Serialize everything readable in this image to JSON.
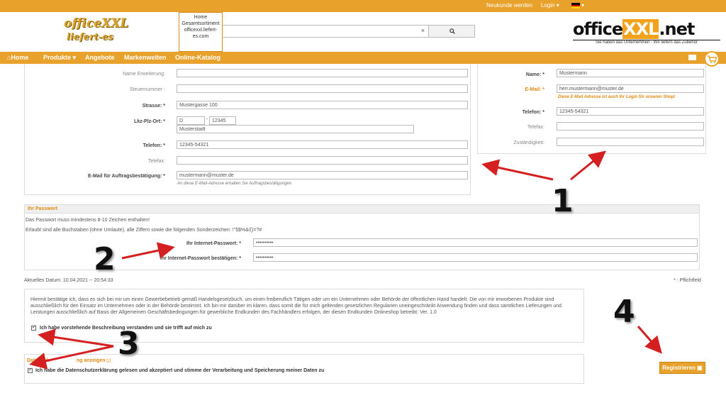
{
  "topbar": {
    "new_customer": "Neukunde werden",
    "login": "Login ▾",
    "language_caret": "▾"
  },
  "header": {
    "logo_left_line1": "officeXXL",
    "logo_left_line2": "liefert-es",
    "search_clear": "×",
    "popup_lines": [
      "Home",
      "Gesamtsortiment",
      "officexxl.liefert-",
      "es.com"
    ],
    "logo_right_office": "office",
    "logo_right_xxl": "XXL",
    "logo_right_net": ".net",
    "logo_right_tagline": "Sie haben das Unternehmen - Wir liefern das Zubehör"
  },
  "nav": {
    "items": [
      "Home",
      "Produkte ▾",
      "Angebote",
      "Markenwelten",
      "Online-Katalog"
    ]
  },
  "form_left": {
    "name_ext_label": "Name Erweiterung:",
    "tax_label": "Steuernummer :",
    "street_label": "Strasse: *",
    "street_value": "Mustergasse 100",
    "zip_label": "Lkz-Plz-Ort: *",
    "country_value": "D",
    "zip_value": "12345",
    "city_value": "Musterstadt",
    "phone_label": "Telefon: *",
    "phone_value": "12345-54321",
    "fax_label": "Telefax:",
    "email_label": "E-Mail für Auftragsbestätigung: *",
    "email_value": "mustermann@muster.de",
    "email_hint": "An diese E-Mail-Adresse erhalten Sie Auftragsbestätigungen"
  },
  "form_right": {
    "name_label": "Name: *",
    "name_value": "Mustermann",
    "email_label": "E-Mail: *",
    "email_value": "herr.mustermann@muster.de",
    "email_hint": "Diese E-Mail Adresse ist auch Ihr Login für unseren Shop!",
    "phone_label": "Telefon: *",
    "phone_value": "12345-54321",
    "fax_label": "Telefax:",
    "resp_label": "Zuständigkeit:"
  },
  "password": {
    "header": "Ihr Passwort",
    "rule1": "Das Passwort muss mindestens 8-10 Zeichen enthalten!",
    "rule2": "Erlaubt sind alle Buchstaben (ohne Umlaute), alle Ziffern sowie die folgenden Sonderzeichen: !\"§$%&/()=?#",
    "pw_label": "Ihr Internet-Passwort: *",
    "pw_value": "••••••••••",
    "pw2_label": "Ihr Internet-Passwort bestätigen: *",
    "pw2_value": "••••••••••"
  },
  "date_line": "Aktuelles Datum: 10.04.2021 -- 20:54:33",
  "required_note": "* : Pflichtfeld",
  "business": {
    "text": "Hiermit bestätige ich, dass es sich bei mir um einen Gewerbebetrieb gemäß Handelsgesetzbuch, um einen freiberuflich Tätigen oder um ein Unternehmen oder Behörde der öffentlichen Hand handelt. Die von mir erworbenen Produkte sind ausschließlich für den Einsatz im Unternehmen oder in der Behörde bestimmt. Ich bin mir darüber im klaren, dass somit die für mich geltenden gesetzlichen Regularien uneingeschränkt Anwendung finden und dass sämtlichen Lieferungen und Leistungen ausschließlich auf Basis der Allgemeinen Geschäftsbedingungen für gewerbliche Endkunden des Fachhändlers erfolgen, der diesen Endkunden Onlineshop betreibt. Ver. 1.0",
    "checkbox_label": "Ich habe vorstehende Beschreibung verstanden und sie trifft auf mich zu"
  },
  "privacy": {
    "link_prefix": "Datensch",
    "link_suffix": "ng anzeigen",
    "checkbox_label": "Ich habe die Datenschutzerklärung gelesen und akzeptiert und stimme der Verarbeitung und Speicherung meiner Daten zu"
  },
  "register_label": "Registrieren",
  "annotations": {
    "n1": "1",
    "n2": "2",
    "n3": "3",
    "n4": "4"
  },
  "colors": {
    "brand": "#e8a12a",
    "arrow": "#d42020"
  }
}
